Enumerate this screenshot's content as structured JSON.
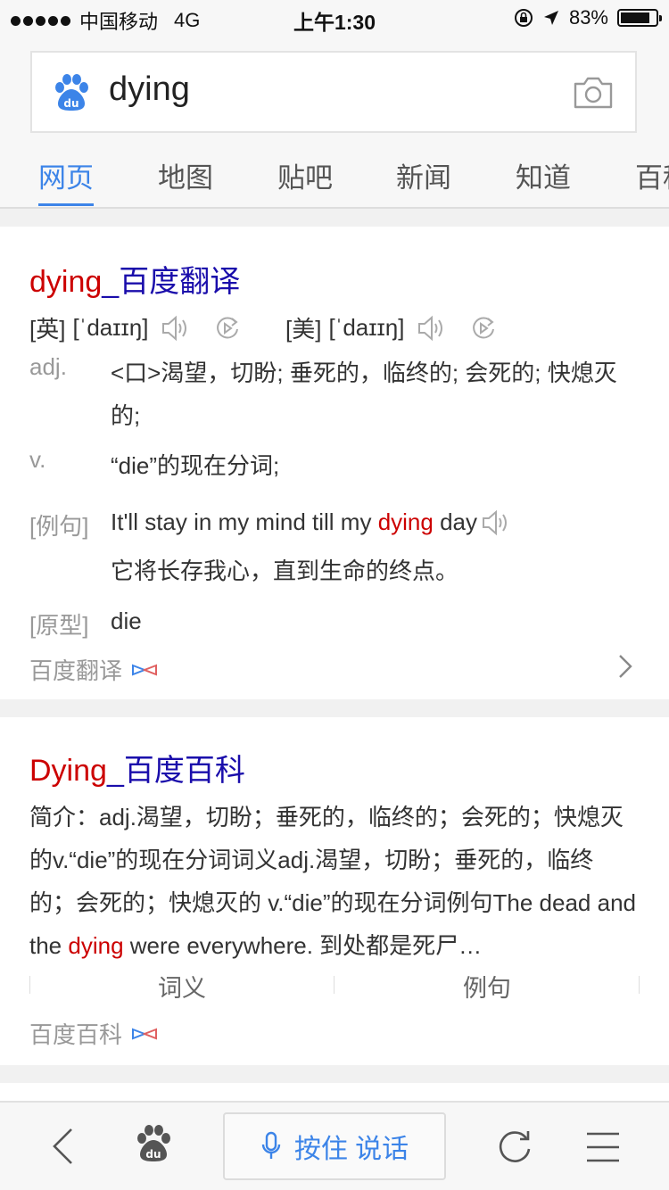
{
  "status_bar": {
    "carrier": "中国移动",
    "network": "4G",
    "time": "上午1:30",
    "battery": "83%",
    "battery_level": 0.83
  },
  "search": {
    "query": "dying"
  },
  "tabs": [
    {
      "label": "网页",
      "active": true
    },
    {
      "label": "地图"
    },
    {
      "label": "贴吧"
    },
    {
      "label": "新闻"
    },
    {
      "label": "知道"
    },
    {
      "label": "百科"
    }
  ],
  "translate_card": {
    "title_word": "dying",
    "title_rest": "_百度翻译",
    "uk_label": "[英]",
    "uk_phonetic": "[ˈdaɪɪŋ]",
    "us_label": "[美]",
    "us_phonetic": "[ˈdaɪɪŋ]",
    "definitions": [
      {
        "pos": "adj.",
        "text": "<口>渴望，切盼; 垂死的，临终的; 会死的; 快熄灭的;"
      },
      {
        "pos": "v.",
        "text": "“die”的现在分词;"
      }
    ],
    "example_label": "[例句]",
    "example_before": "It'll stay in my mind till my ",
    "example_highlight": "dying",
    "example_after": " day",
    "example_translation": "它将长存我心，直到生命的终点。",
    "base_label": "[原型]",
    "base_word": "die",
    "source": "百度翻译"
  },
  "baike_card": {
    "title_word": "Dying",
    "title_rest": "_百度百科",
    "abstract_before": "简介：adj.渴望，切盼；垂死的，临终的；会死的；快熄灭的v.“die”的现在分词词义adj.渴望，切盼；垂死的，临终的；会死的；快熄灭的 v.“die”的现在分词例句The dead and the ",
    "abstract_highlight": "dying",
    "abstract_after": " were everywhere. 到处都是死尸…",
    "subtabs": [
      "词义",
      "例句"
    ],
    "source": "百度百科"
  },
  "bottom_bar": {
    "voice_label": "按住 说话"
  },
  "colors": {
    "accent": "#3c84e8",
    "title_red": "#cc0000",
    "title_blue": "#1a0dab"
  }
}
